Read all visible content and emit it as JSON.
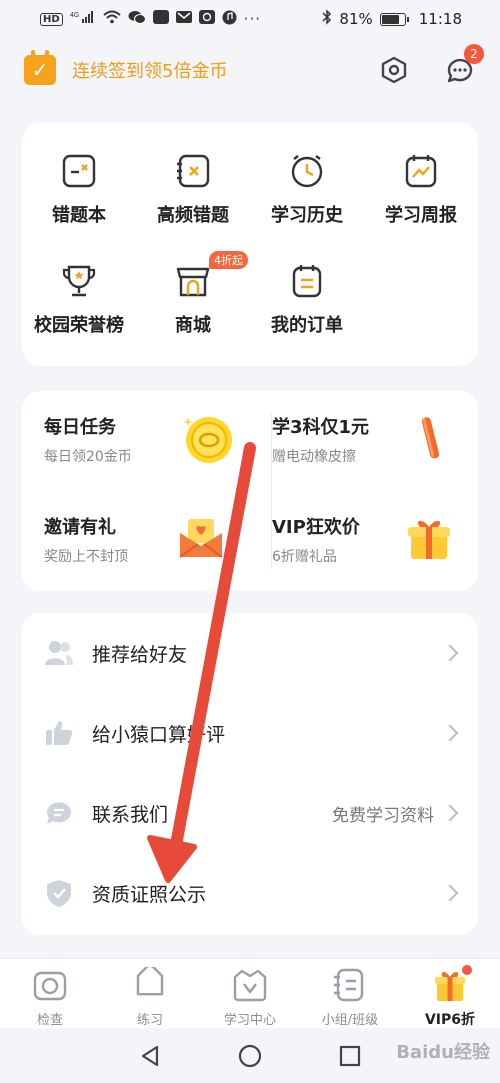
{
  "status_bar": {
    "battery_text": "81%",
    "battery_level": 0.81,
    "time": "11:18",
    "signal_label": "4G"
  },
  "header": {
    "checkin_text": "连续签到领5倍金币",
    "message_badge": "2"
  },
  "grid": {
    "items": [
      {
        "label": "错题本",
        "icon": "mistake-book-icon"
      },
      {
        "label": "高频错题",
        "icon": "frequent-mistakes-icon"
      },
      {
        "label": "学习历史",
        "icon": "clock-icon"
      },
      {
        "label": "学习周报",
        "icon": "weekly-report-icon"
      },
      {
        "label": "校园荣誉榜",
        "icon": "trophy-icon"
      },
      {
        "label": "商城",
        "icon": "store-icon",
        "tag": "4折起"
      },
      {
        "label": "我的订单",
        "icon": "orders-icon"
      }
    ]
  },
  "tasks": {
    "items": [
      {
        "title": "每日任务",
        "subtitle": "每日领20金币",
        "icon": "coin-icon"
      },
      {
        "title": "学3科仅1元",
        "subtitle": "赠电动橡皮擦",
        "icon": "eraser-icon"
      },
      {
        "title": "邀请有礼",
        "subtitle": "奖励上不封顶",
        "icon": "envelope-icon"
      },
      {
        "title": "VIP狂欢价",
        "subtitle": "6折赠礼品",
        "icon": "gift-icon"
      }
    ]
  },
  "list": {
    "items": [
      {
        "label": "推荐给好友",
        "icon": "friends-icon",
        "extra": ""
      },
      {
        "label": "给小猿口算好评",
        "icon": "thumbs-up-icon",
        "extra": ""
      },
      {
        "label": "联系我们",
        "icon": "chat-icon",
        "extra": "免费学习资料"
      },
      {
        "label": "资质证照公示",
        "icon": "shield-icon",
        "extra": ""
      }
    ]
  },
  "tabbar": {
    "items": [
      {
        "label": "检查",
        "icon": "camera-icon"
      },
      {
        "label": "练习",
        "icon": "tag-icon"
      },
      {
        "label": "学习中心",
        "icon": "study-center-icon"
      },
      {
        "label": "小组/班级",
        "icon": "group-icon"
      },
      {
        "label": "VIP6折",
        "icon": "vip-gift-icon",
        "active": true
      }
    ]
  },
  "watermark": "Baidu经验",
  "colors": {
    "accent_orange": "#f29b15",
    "badge_red": "#f5573f",
    "arrow_red": "#e84a3a"
  }
}
